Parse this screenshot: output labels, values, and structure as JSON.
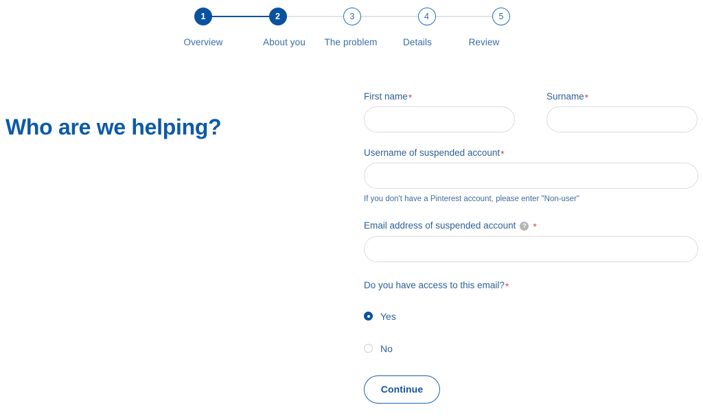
{
  "stepper": {
    "steps": [
      {
        "number": "1",
        "label": "Overview",
        "state": "done"
      },
      {
        "number": "2",
        "label": "About you",
        "state": "current"
      },
      {
        "number": "3",
        "label": "The problem",
        "state": "todo"
      },
      {
        "number": "4",
        "label": "Details",
        "state": "todo"
      },
      {
        "number": "5",
        "label": "Review",
        "state": "todo"
      }
    ],
    "active_color": "#0a52a0",
    "inactive_color": "#e3e5e8",
    "label_color": "#3a6ea5"
  },
  "heading": "Who are we helping?",
  "form": {
    "first_name": {
      "label": "First name",
      "required_mark": "*",
      "value": "",
      "placeholder": ""
    },
    "surname": {
      "label": "Surname",
      "required_mark": "*",
      "value": "",
      "placeholder": ""
    },
    "username": {
      "label": "Username of suspended account",
      "required_mark": "*",
      "value": "",
      "placeholder": "",
      "helper": "If you don't have a Pinterest account, please enter \"Non-user\""
    },
    "email": {
      "label": "Email address of suspended account",
      "help_icon": "question-mark-icon",
      "help_icon_glyph": "?",
      "required_mark": "*",
      "value": "",
      "placeholder": ""
    },
    "email_access": {
      "label": "Do you have access to this email?",
      "required_mark": "*",
      "options": [
        {
          "label": "Yes",
          "selected": true
        },
        {
          "label": "No",
          "selected": false
        }
      ]
    },
    "submit_label": "Continue",
    "required_color": "#e0414b",
    "label_color": "#2e5f96",
    "accent_color": "#14539c"
  }
}
